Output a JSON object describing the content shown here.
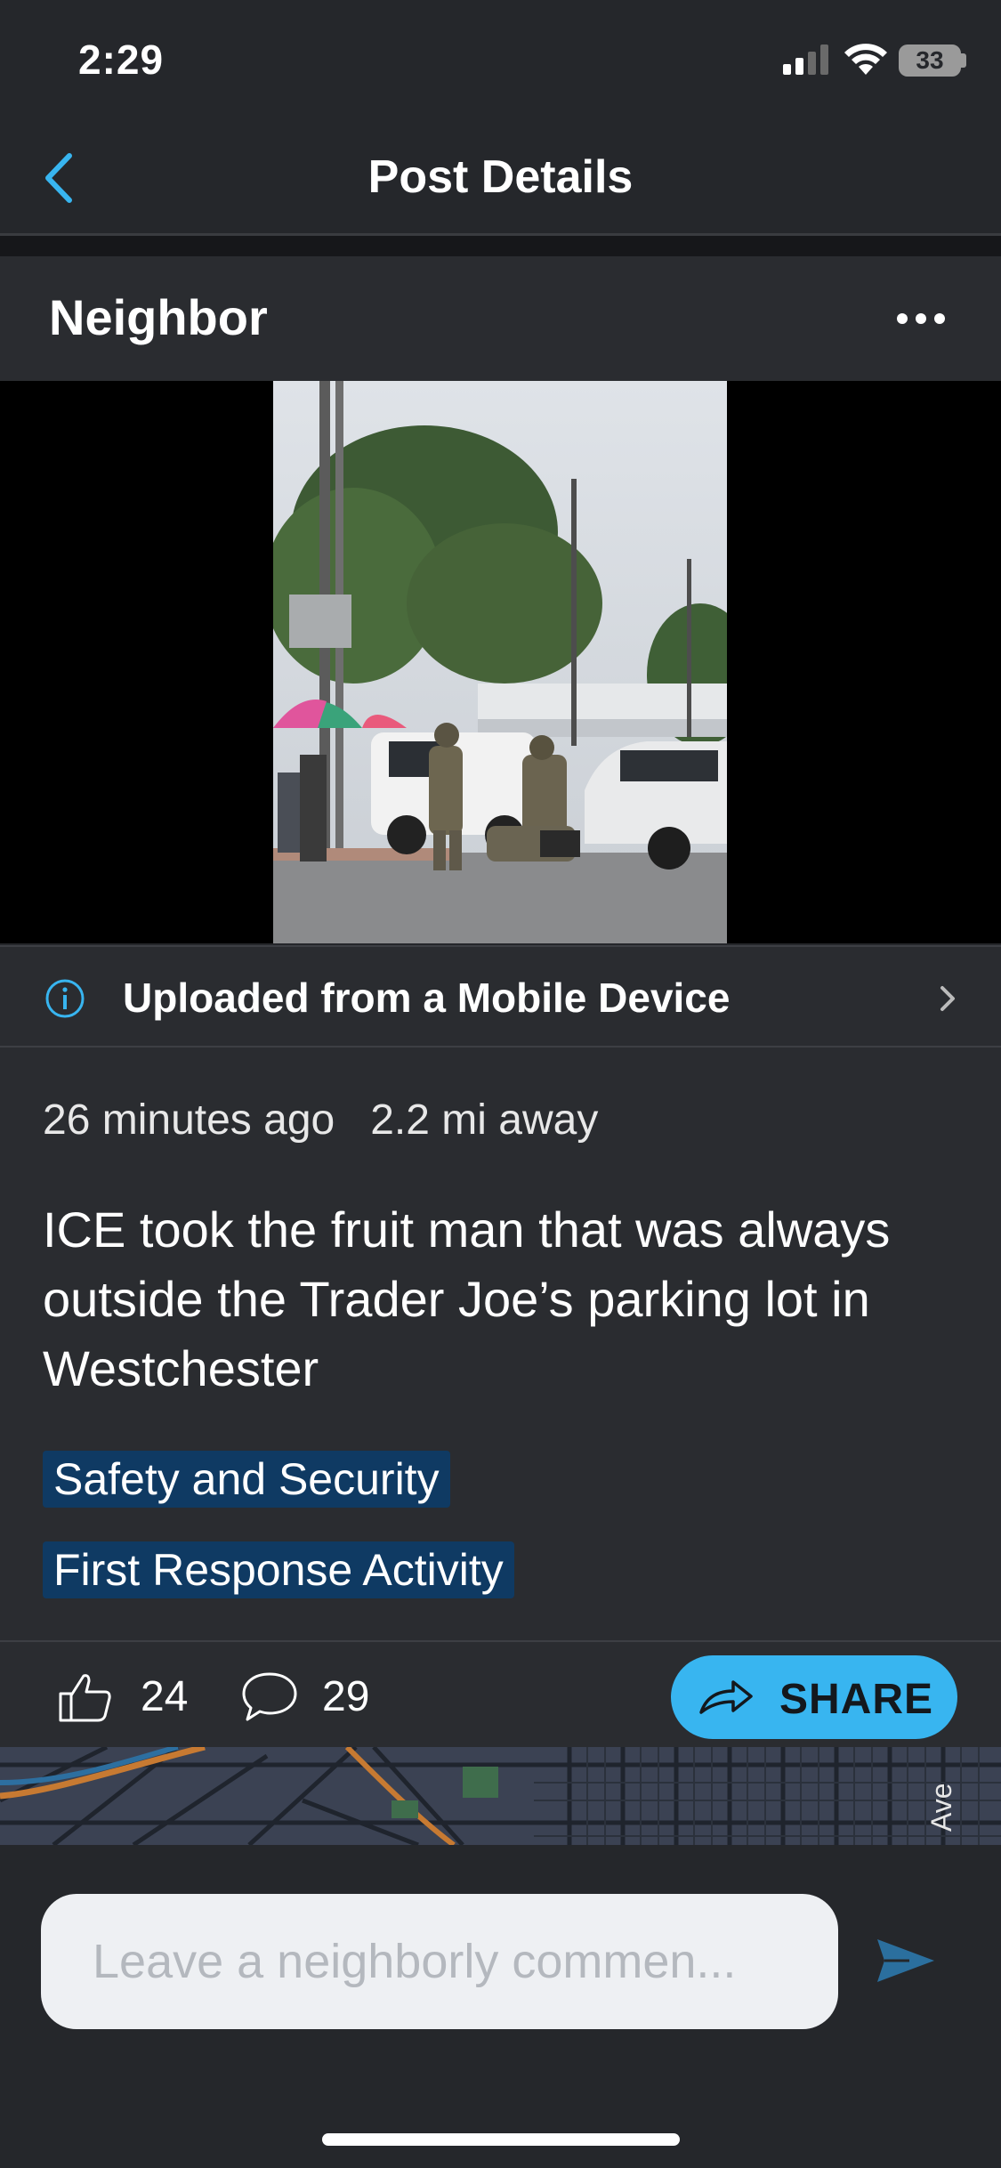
{
  "status_bar": {
    "time": "2:29",
    "battery": "33"
  },
  "nav": {
    "title": "Post Details",
    "back_icon": "chevron-left-icon"
  },
  "post": {
    "author": "Neighbor",
    "more_icon": "ellipsis-icon",
    "upload_info": "Uploaded from a Mobile Device",
    "time_ago": "26 minutes ago",
    "distance": "2.2 mi away",
    "text": "ICE took the fruit man that was always outside the Trader Joe’s parking lot in Westchester",
    "tags": [
      "Safety and Security",
      "First Response Activity"
    ],
    "likes": "24",
    "comments": "29",
    "share_label": "SHARE"
  },
  "map": {
    "street_label": "Ave"
  },
  "comment_box": {
    "placeholder": "Leave a neighborly commen..."
  },
  "colors": {
    "accent": "#38b5f0",
    "tag_bg": "#0f3a63",
    "background": "#25272b",
    "card": "#2a2c30"
  }
}
